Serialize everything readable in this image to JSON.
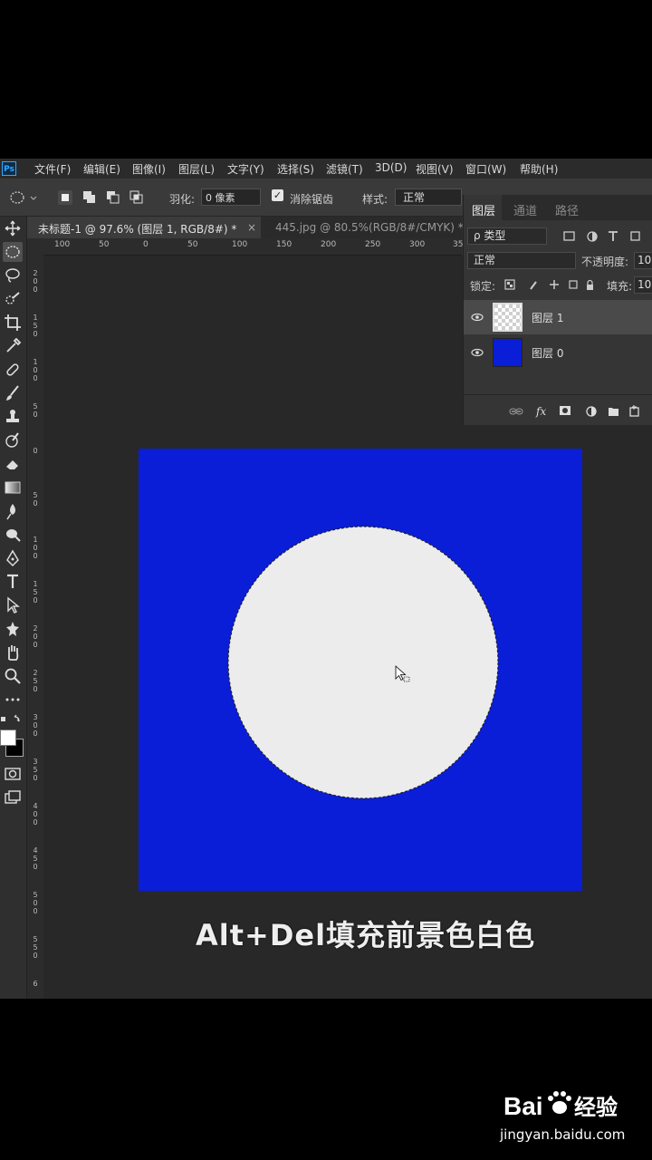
{
  "menu": [
    "文件(F)",
    "编辑(E)",
    "图像(I)",
    "图层(L)",
    "文字(Y)",
    "选择(S)",
    "滤镜(T)",
    "3D(D)",
    "视图(V)",
    "窗口(W)",
    "帮助(H)"
  ],
  "app_logo": "Ps",
  "options": {
    "feather_label": "羽化:",
    "feather_value": "0 像素",
    "antialias_label": "消除锯齿",
    "antialias_checked": true,
    "style_label": "样式:",
    "style_value": "正常"
  },
  "tabs": [
    {
      "title": "未标题-1 @ 97.6% (图层 1, RGB/8#) *",
      "close": "×"
    },
    {
      "title": "445.jpg @ 80.5%(RGB/8#/CMYK) *",
      "close": "×"
    }
  ],
  "ruler_top": [
    "100",
    "50",
    "0",
    "50",
    "100",
    "150",
    "200",
    "250",
    "300",
    "35"
  ],
  "ruler_left": [
    "2\n0\n0",
    "1\n5\n0",
    "1\n0\n0",
    "5\n0",
    "0",
    "5\n0",
    "1\n0\n0",
    "1\n5\n0",
    "2\n0\n0",
    "2\n5\n0",
    "3\n0\n0",
    "3\n5\n0",
    "4\n0\n0",
    "4\n5\n0",
    "5\n0\n0",
    "5\n5\n0",
    "6"
  ],
  "layers_panel": {
    "tabs": [
      "图层",
      "通道",
      "路径"
    ],
    "filter_value": "ρ 类型",
    "blend_mode": "正常",
    "opacity_label": "不透明度:",
    "opacity_value": "10",
    "lock_label": "锁定:",
    "fill_label": "填充:",
    "fill_value": "10",
    "layers": [
      {
        "name": "图层 1",
        "selected": true,
        "thumb": "transparent"
      },
      {
        "name": "图层 0",
        "selected": false,
        "thumb": "blue"
      }
    ],
    "footer_icons": [
      "link-icon",
      "fx",
      "mask-icon",
      "adjustment-icon",
      "folder-icon",
      "new-layer-icon"
    ]
  },
  "canvas": {
    "doc_color": "#0a1dd7",
    "circle_color": "#ececec"
  },
  "caption": "Alt+Del填充前景色白色",
  "watermark": {
    "logo": "Bai  经验",
    "url": "jingyan.baidu.com"
  }
}
